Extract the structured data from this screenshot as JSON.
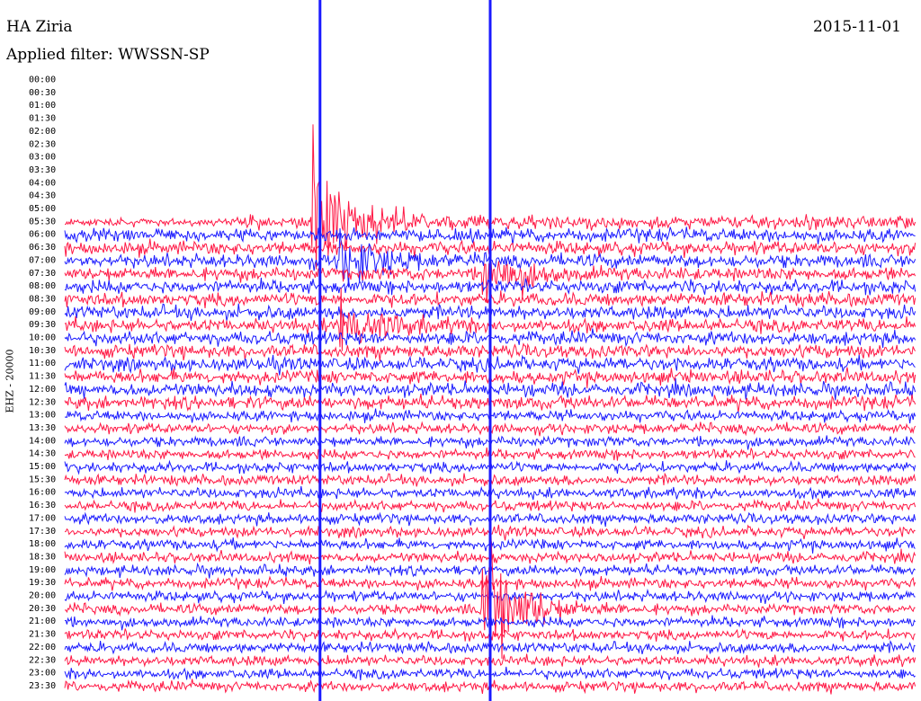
{
  "header": {
    "station": "HA Ziria",
    "date": "2015-11-01",
    "filter": "Applied filter: WWSSN-SP"
  },
  "colors": {
    "series_a": "#ff1744",
    "series_b": "#1a1aff",
    "background": "#ffffff"
  },
  "chart_data": {
    "type": "line",
    "title": "HA Ziria",
    "ylabel": "EHZ - 20000",
    "xlabel": "",
    "row_labels": [
      "00:00",
      "00:30",
      "01:00",
      "01:30",
      "02:00",
      "02:30",
      "03:00",
      "03:30",
      "04:00",
      "04:30",
      "05:00",
      "05:30",
      "06:00",
      "06:30",
      "07:00",
      "07:30",
      "08:00",
      "08:30",
      "09:00",
      "09:30",
      "10:00",
      "10:30",
      "11:00",
      "11:30",
      "12:00",
      "12:30",
      "13:00",
      "13:30",
      "14:00",
      "14:30",
      "15:00",
      "15:30",
      "16:00",
      "16:30",
      "17:00",
      "17:30",
      "18:00",
      "18:30",
      "19:00",
      "19:30",
      "20:00",
      "20:30",
      "21:00",
      "21:30",
      "22:00",
      "22:30",
      "23:00",
      "23:30"
    ],
    "row_minutes": 30,
    "first_data_row": "05:30",
    "data_start_minute_of_day": 330,
    "colors_alternate": [
      "blue",
      "red"
    ],
    "events": [
      {
        "time": "05:39",
        "amplitude": "large"
      },
      {
        "time": "07:10",
        "amplitude": "moderate"
      },
      {
        "time": "07:45",
        "amplitude": "moderate"
      },
      {
        "time": "09:40",
        "amplitude": "moderate"
      },
      {
        "time": "20:45",
        "amplitude": "large"
      }
    ],
    "grid": false,
    "legend": "none"
  }
}
